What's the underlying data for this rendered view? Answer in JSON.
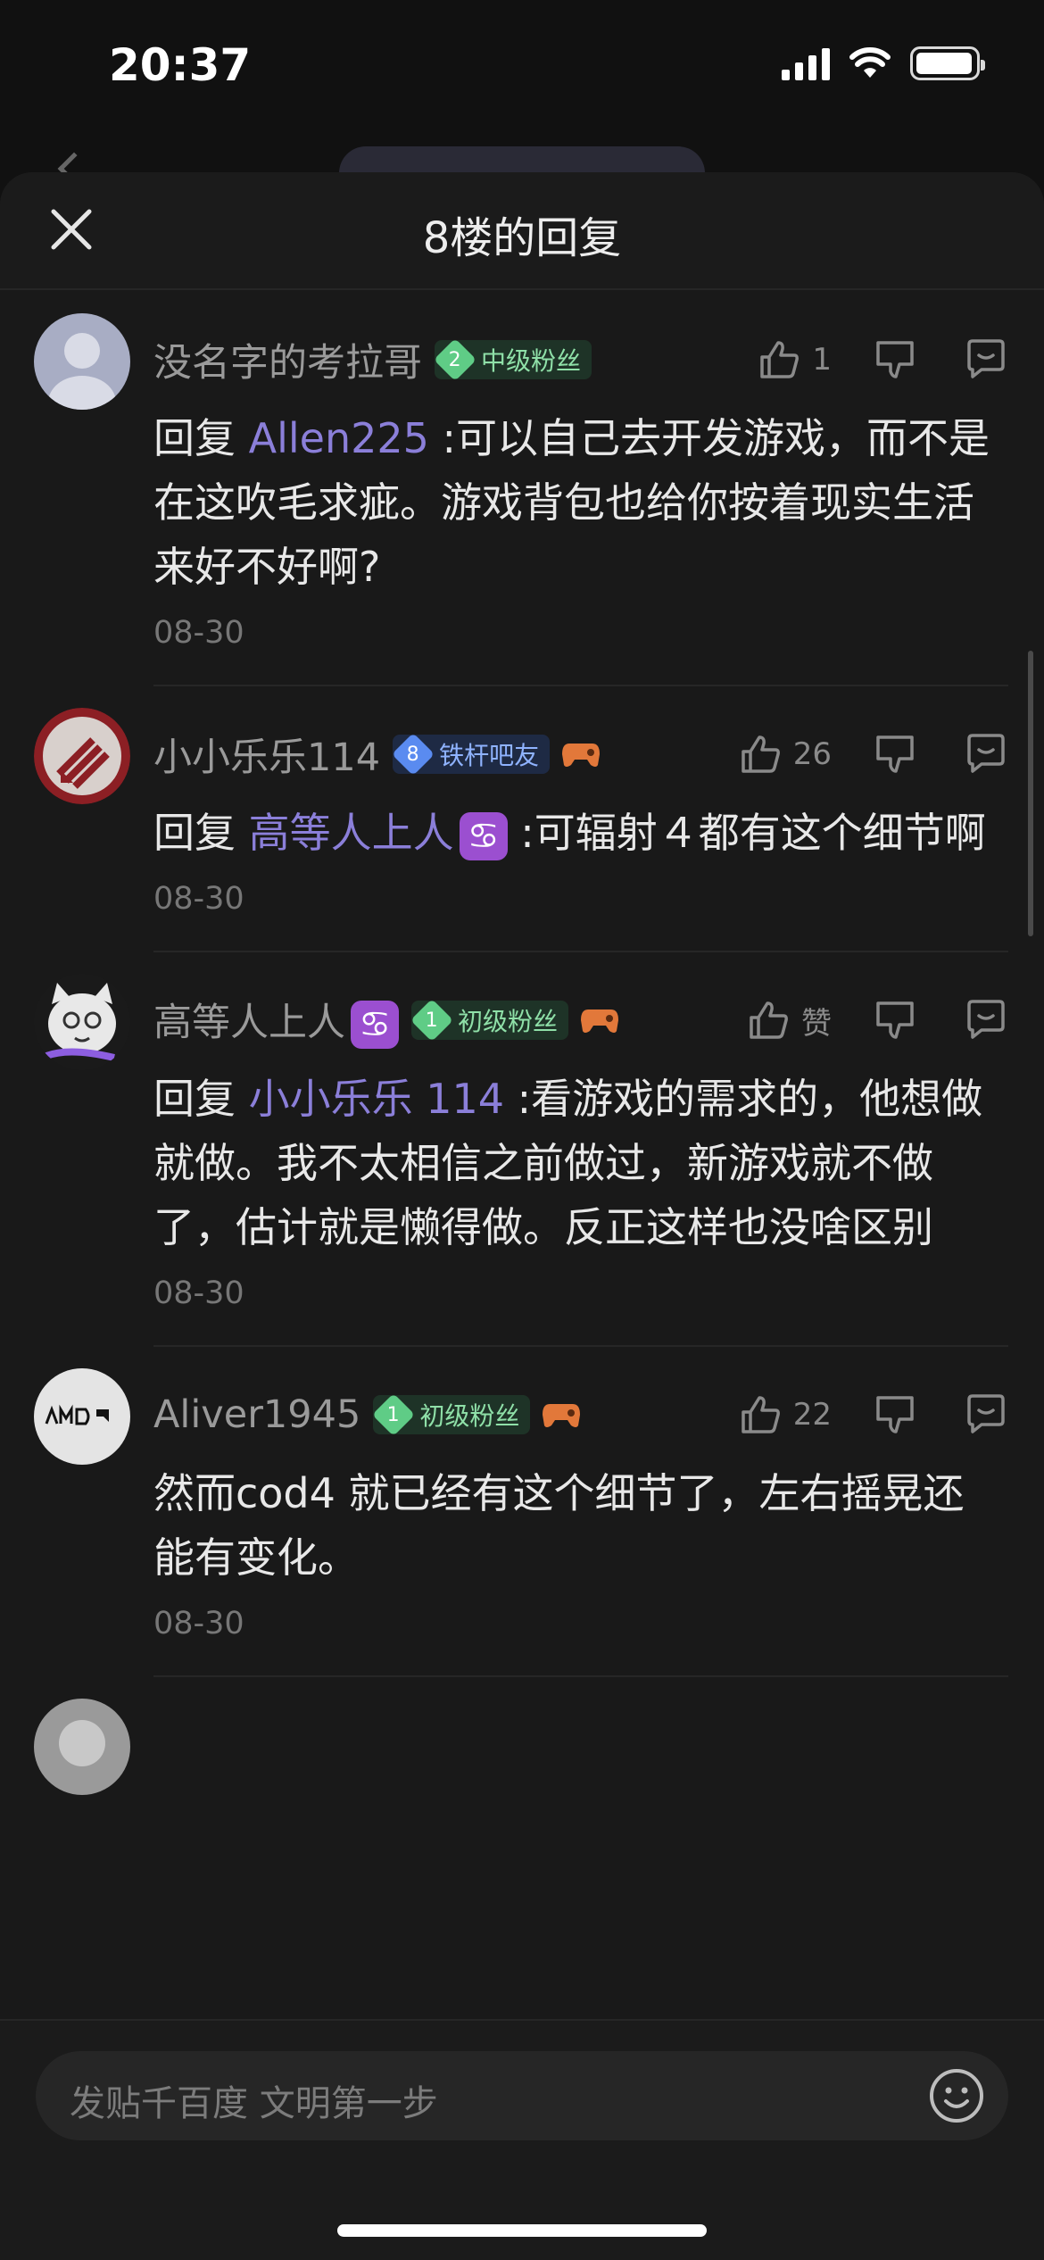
{
  "status": {
    "time": "20:37"
  },
  "sheet": {
    "title": "8楼的回复"
  },
  "comments": [
    {
      "user": "没名字的考拉哥",
      "badge_level": "2",
      "badge_label": "中级粉丝",
      "likes": "1",
      "reply_prefix": "回复 ",
      "reply_to": "Allen225",
      "text": ":可以自己去开发游戏，而不是在这吹毛求疵。游戏背包也给你按着现实生活来好不好啊?",
      "date": "08-30"
    },
    {
      "user": "小小乐乐114",
      "badge_level": "8",
      "badge_label": "铁杆吧友",
      "likes": "26",
      "reply_prefix": "回复 ",
      "reply_to": "高等人上人",
      "reply_zodiac": "♋",
      "text": " :可辐射４都有这个细节啊",
      "date": "08-30"
    },
    {
      "user": "高等人上人",
      "user_zodiac": "♋",
      "badge_level": "1",
      "badge_label": "初级粉丝",
      "likes": "赞",
      "reply_prefix": "回复 ",
      "reply_to": "小小乐乐 114",
      "text": " :看游戏的需求的，他想做就做。我不太相信之前做过，新游戏就不做了，估计就是懒得做。反正这样也没啥区别",
      "date": "08-30"
    },
    {
      "user": "Aliver1945",
      "badge_level": "1",
      "badge_label": "初级粉丝",
      "likes": "22",
      "text": "然而cod4 就已经有这个细节了，左右摇晃还能有变化。",
      "date": "08-30"
    }
  ],
  "input": {
    "placeholder": "发贴千百度 文明第一步"
  },
  "colors": {
    "mention": "#8b7fd9",
    "badge_green": "#5fcc86",
    "badge_blue": "#5a8bf0"
  }
}
